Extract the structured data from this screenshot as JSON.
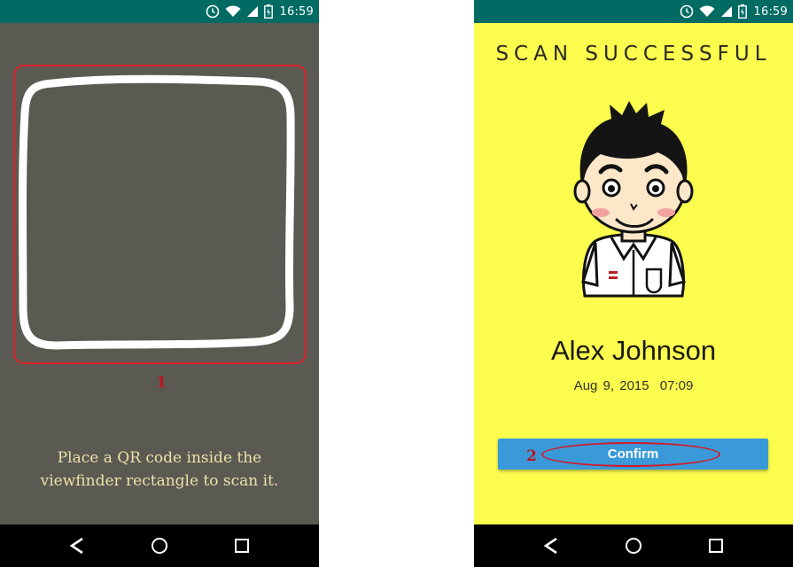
{
  "status_bar": {
    "time": "16:59"
  },
  "scan_screen": {
    "instructions_line1": "Place a QR code inside the",
    "instructions_line2": "viewfinder rectangle to scan it.",
    "annotation_label": "1"
  },
  "success_screen": {
    "heading": "SCAN SUCCESSFUL",
    "user_name": "Alex Johnson",
    "scan_date": "Aug 9, 2015",
    "scan_time": "07:09",
    "confirm_label": "Confirm",
    "annotation_label": "2"
  },
  "colors": {
    "status_bar": "#006b63",
    "scan_background": "#5a5a52",
    "success_background": "#fbfc4e",
    "confirm_button": "#3a9ad9",
    "annotation_red": "#e0202a"
  },
  "icons": [
    "alarm-icon",
    "wifi-icon",
    "signal-icon",
    "battery-icon",
    "back-icon",
    "home-icon",
    "recents-icon"
  ]
}
